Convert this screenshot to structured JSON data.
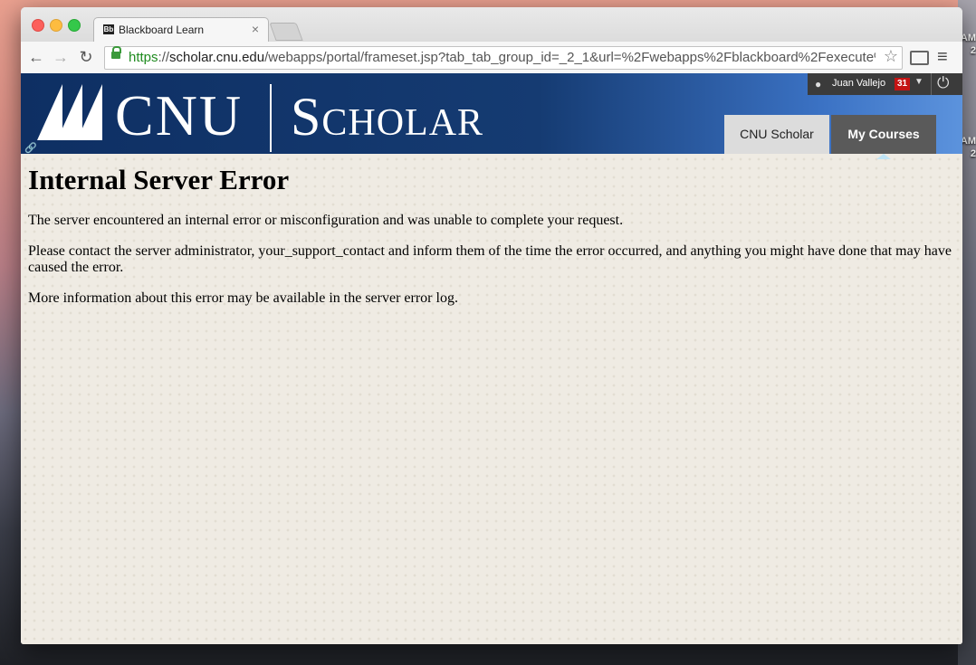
{
  "desktop": {
    "right_labels": [
      "AM",
      "2",
      "AM",
      "2"
    ]
  },
  "browser": {
    "tab_title": "Blackboard Learn",
    "tab_favicon": "Bb",
    "tab_close": "×",
    "url_scheme": "https",
    "url_sep": "://",
    "url_host": "scholar.cnu.edu",
    "url_path": "/webapps/portal/frameset.jsp?tab_tab_group_id=_2_1&url=%2Fwebapps%2Fblackboard%2Fexecute%...",
    "icons": {
      "back": "back-arrow-icon",
      "forward": "forward-arrow-icon",
      "reload": "reload-icon",
      "lock": "lock-icon",
      "star": "star-icon",
      "cast": "cast-icon",
      "menu": "menu-icon"
    }
  },
  "header": {
    "logo_cnu": "CNU",
    "logo_scholar": "Scholar",
    "user_name": "Juan Vallejo",
    "notification_count": "31",
    "tabs": [
      {
        "label": "CNU Scholar",
        "active": false
      },
      {
        "label": "My Courses",
        "active": true
      }
    ],
    "colors": {
      "header_dark": "#0e2f63",
      "header_light": "#5c93dd",
      "badge": "#c41414"
    }
  },
  "error": {
    "title": "Internal Server Error",
    "p1": "The server encountered an internal error or misconfiguration and was unable to complete your request.",
    "p2": "Please contact the server administrator, your_support_contact and inform them of the time the error occurred, and anything you might have done that may have caused the error.",
    "p3": "More information about this error may be available in the server error log."
  }
}
